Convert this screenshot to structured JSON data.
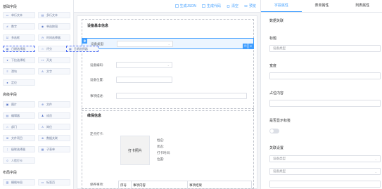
{
  "palette": {
    "groups": [
      {
        "title": "基础字段",
        "items": [
          {
            "label": "单行文本",
            "icon": "text-icon"
          },
          {
            "label": "多行文本",
            "icon": "textarea-icon"
          },
          {
            "label": "数字",
            "icon": "number-icon"
          },
          {
            "label": "单选按钮",
            "icon": "radio-icon"
          },
          {
            "label": "多选框",
            "icon": "checkbox-icon"
          },
          {
            "label": "时间选择器",
            "icon": "clock-icon"
          },
          {
            "label": "日期选择器",
            "icon": "calendar-icon"
          },
          {
            "label": "评分",
            "icon": "star-icon"
          },
          {
            "label": "下拉选择框",
            "icon": "select-icon"
          },
          {
            "label": "开关",
            "icon": "switch-icon"
          },
          {
            "label": "滑块",
            "icon": "slider-icon"
          },
          {
            "label": "文字",
            "icon": "font-icon"
          },
          {
            "label": "定位",
            "icon": "location-icon"
          }
        ]
      },
      {
        "title": "高级字段",
        "items": [
          {
            "label": "图片",
            "icon": "image-icon"
          },
          {
            "label": "文件",
            "icon": "file-icon"
          },
          {
            "label": "编辑器",
            "icon": "editor-icon"
          },
          {
            "label": "成员",
            "icon": "member-icon"
          },
          {
            "label": "部门",
            "icon": "department-icon"
          },
          {
            "label": "岗位",
            "icon": "position-icon"
          },
          {
            "label": "文件项目",
            "icon": "folder-icon"
          },
          {
            "label": "数据关联",
            "icon": "link-icon"
          },
          {
            "label": "级联选择器",
            "icon": "cascader-icon"
          },
          {
            "label": "子表单",
            "icon": "subform-icon"
          },
          {
            "label": "人脸打卡",
            "icon": "face-icon"
          }
        ]
      },
      {
        "title": "布局字段",
        "items": [
          {
            "label": "栅格布局",
            "icon": "grid-icon"
          },
          {
            "label": "标签页",
            "icon": "tabs-icon"
          }
        ]
      }
    ]
  },
  "toolbar": {
    "json": "生成JSON",
    "code": "生成代码",
    "clear": "清空",
    "preview": "预览"
  },
  "form": {
    "section1": "设备基本信息",
    "device_type": "设备类型:",
    "device_code": "设备编码:",
    "device_location": "设备位置:",
    "description": "事项描述:",
    "drag_ghost": "日期选择器",
    "section2": "维保信息",
    "checkin_label": "定点打卡:",
    "photo": "打卡照片",
    "info": [
      "姓名:",
      "状态:",
      "打卡时间:",
      "位置:"
    ],
    "maint_label": "保养事项:",
    "table_headers": [
      "序号",
      "事项内容",
      "事项结果"
    ]
  },
  "props": {
    "tabs": [
      "字段属性",
      "表单属性",
      "列表属性"
    ],
    "data_link": "数据关联",
    "title_label": "标题",
    "title_value": "设备类型",
    "width_label": "宽度",
    "placeholder_label": "占位内容",
    "show_label": "是否显示标签",
    "link_settings": "关联设置",
    "select1": "设备类型",
    "select2": "设备类型"
  },
  "colors": {
    "accent": "#409eff",
    "palette_text": "#4e6ef2"
  }
}
